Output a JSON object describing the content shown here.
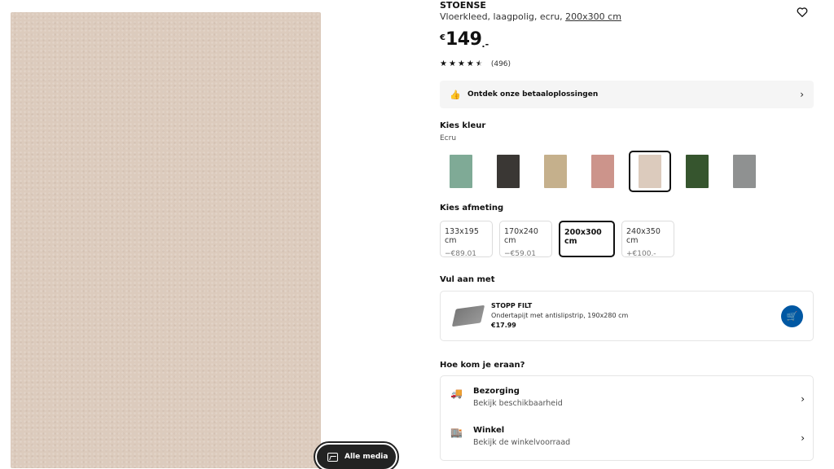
{
  "product": {
    "name": "STOENSE",
    "description": "Vloerkleed, laagpolig, ecru,",
    "size_link": "200x300 cm",
    "price_currency": "€",
    "price_amount": "149",
    "price_decimals": ".-",
    "rating": 4.5,
    "review_count": "(496)"
  },
  "media": {
    "button_label": "Alle media"
  },
  "payment": {
    "label": "Ontdek onze betaaloplossingen"
  },
  "color": {
    "heading": "Kies kleur",
    "selected": "Ecru",
    "swatches": [
      "#7faa96",
      "#3a3734",
      "#c5b08c",
      "#cc948b",
      "#dccbbd",
      "#36552e",
      "#8f9191"
    ]
  },
  "size": {
    "heading": "Kies afmeting",
    "options": [
      {
        "label": "133x195 cm",
        "diff": "−€89.01"
      },
      {
        "label": "170x240 cm",
        "diff": "−€59.01"
      },
      {
        "label": "200x300 cm",
        "diff": ""
      },
      {
        "label": "240x350 cm",
        "diff": "+€100.-"
      }
    ]
  },
  "addon": {
    "heading": "Vul aan met",
    "name": "STOPP FILT",
    "desc": "Ondertapijt met antislipstrip, 190x280 cm",
    "price": "€17.99"
  },
  "delivery": {
    "heading": "Hoe kom je eraan?",
    "items": [
      {
        "title": "Bezorging",
        "sub": "Bekijk beschikbaarheid"
      },
      {
        "title": "Winkel",
        "sub": "Bekijk de winkelvoorraad"
      }
    ]
  }
}
